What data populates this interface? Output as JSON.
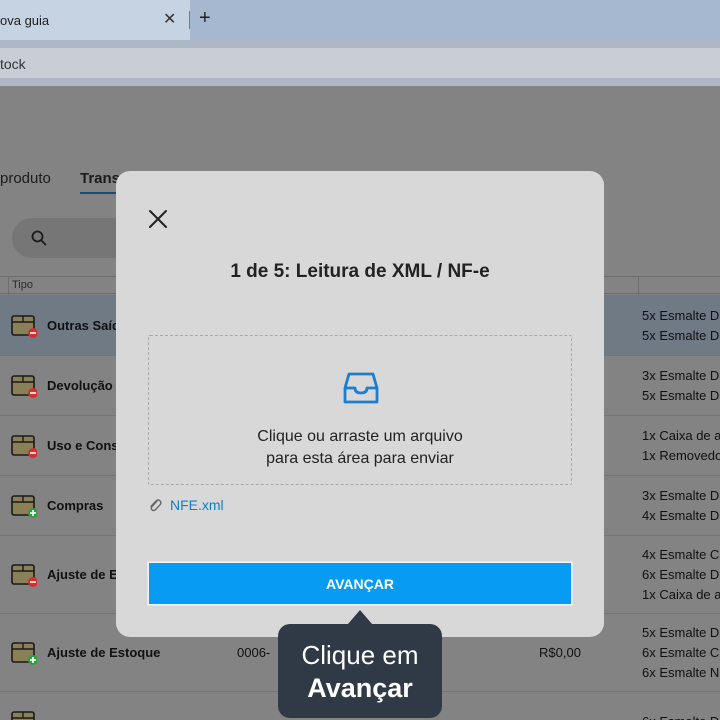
{
  "browser": {
    "tab_title": "ova guia",
    "close_glyph": "✕",
    "new_tab_glyph": "+",
    "address_text": "tock"
  },
  "app": {
    "nav_tabs": [
      {
        "label": "produto",
        "active": false
      },
      {
        "label": "Trans",
        "active": true
      }
    ],
    "table_header_type": "Tipo",
    "rows": [
      {
        "type": "Outras Saíd",
        "code": "",
        "price": "",
        "items": [
          "5x Esmalte D",
          "5x Esmalte D"
        ],
        "badge": "minus",
        "selected": true
      },
      {
        "type": "Devolução",
        "code": "",
        "price": "",
        "items": [
          "3x Esmalte D",
          "5x Esmalte D"
        ],
        "badge": "minus",
        "selected": false
      },
      {
        "type": "Uso e Cons",
        "code": "",
        "price": "",
        "items": [
          "1x Caixa de a",
          "1x Removedo"
        ],
        "badge": "minus",
        "selected": false
      },
      {
        "type": "Compras",
        "code": "",
        "price": "",
        "items": [
          "3x Esmalte D",
          "4x Esmalte D"
        ],
        "badge": "plus",
        "selected": false
      },
      {
        "type": "Ajuste de E",
        "code": "",
        "price": "",
        "items": [
          "4x Esmalte C",
          "6x Esmalte D",
          "1x Caixa de a"
        ],
        "badge": "minus",
        "selected": false
      },
      {
        "type": "Ajuste de Estoque",
        "code": "0006-",
        "price": "R$0,00",
        "items": [
          "5x Esmalte D",
          "6x Esmalte C",
          "6x Esmalte N"
        ],
        "badge": "plus",
        "selected": false
      },
      {
        "type": "",
        "code": "",
        "price": "",
        "items": [
          "6x Esmalte D"
        ],
        "badge": "minus",
        "selected": false
      }
    ]
  },
  "modal": {
    "title": "1 de 5: Leitura de XML / NF-e",
    "drop_line1": "Clique ou arraste um arquivo",
    "drop_line2": "para esta área para enviar",
    "file_name": "NFE.xml",
    "advance_label": "AVANÇAR"
  },
  "tooltip": {
    "line1": "Clique em",
    "line2": "Avançar"
  },
  "colors": {
    "primary": "#079cf2",
    "link": "#0d7fc7",
    "tooltip_bg": "#2f3a46",
    "badge_minus": "#d32f2f",
    "badge_plus": "#2e9e3e"
  },
  "icons": {
    "close": "close-icon",
    "inbox": "inbox-icon",
    "attachment": "paperclip-icon",
    "search": "search-icon",
    "row_box": "box-icon"
  }
}
